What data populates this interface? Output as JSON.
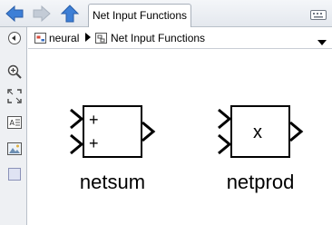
{
  "toolbar": {
    "tab_label": "Net Input Functions",
    "icons": [
      "back-arrow-icon",
      "forward-arrow-icon",
      "up-arrow-icon",
      "keyboard-icon"
    ]
  },
  "breadcrumb": {
    "root": "neural",
    "current": "Net Input Functions"
  },
  "palette": {
    "icons": [
      "collapse-icon",
      "zoom-in-icon",
      "fit-to-view-icon",
      "annotation-icon",
      "image-icon",
      "area-icon"
    ]
  },
  "blocks": [
    {
      "name": "netsum",
      "ports": [
        "+",
        "+"
      ]
    },
    {
      "name": "netprod",
      "operator": "x"
    }
  ],
  "colors": {
    "nav_arrow_active": "#3d7fd6",
    "nav_arrow_disabled": "#c3cbd6",
    "block_border": "#000000"
  }
}
